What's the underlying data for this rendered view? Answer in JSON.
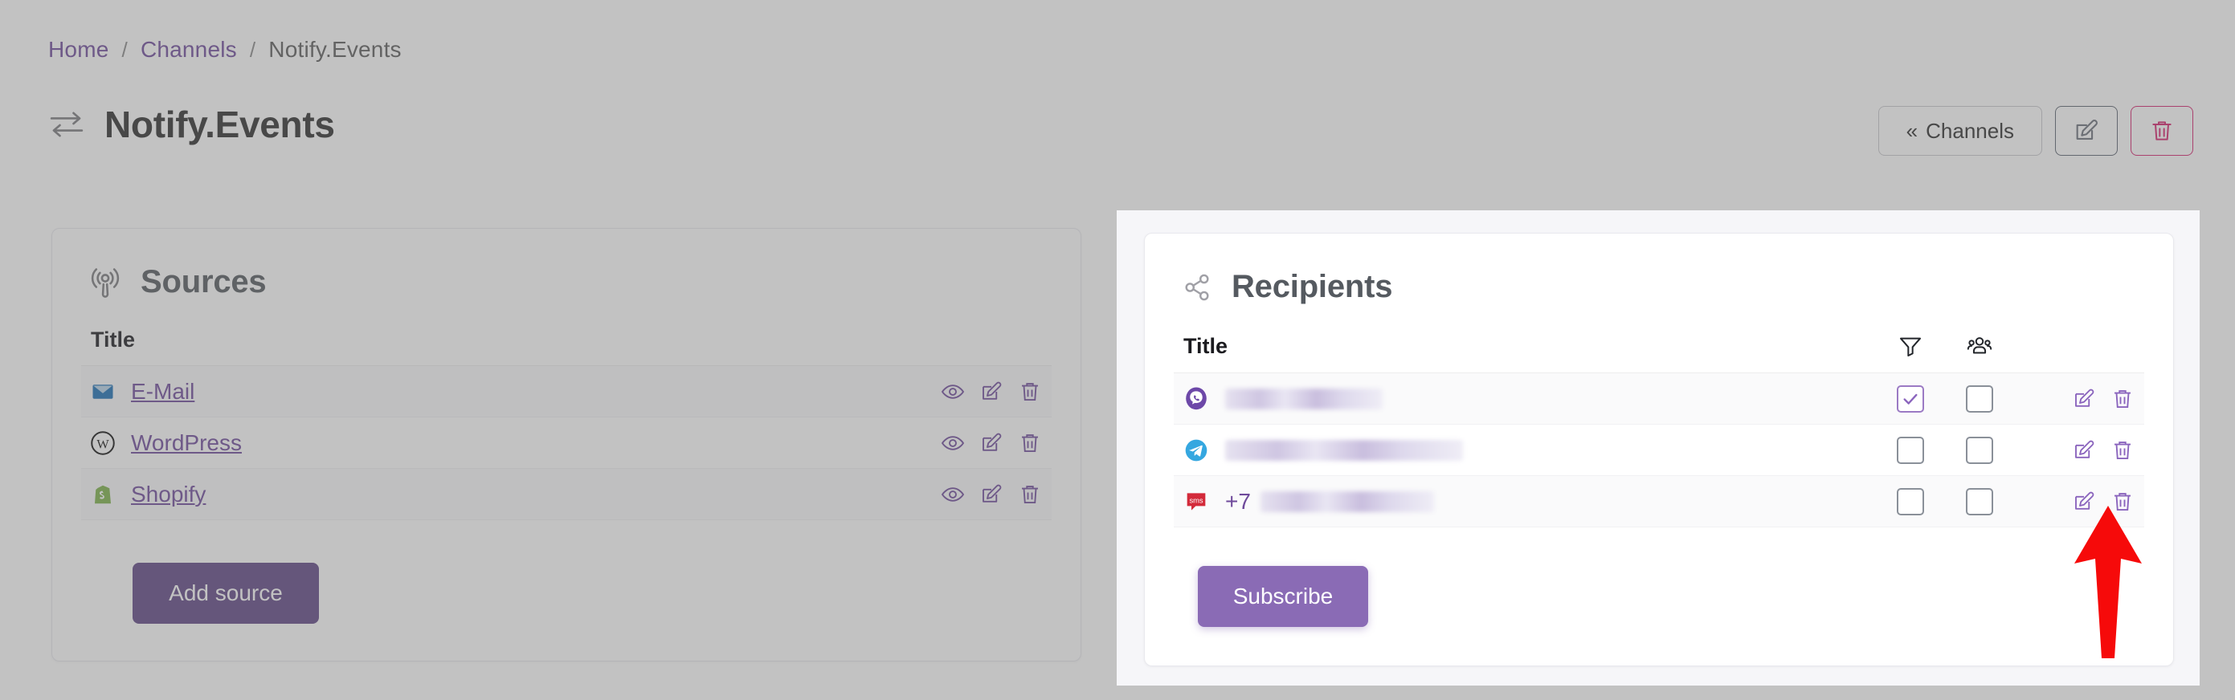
{
  "breadcrumb": {
    "items": [
      {
        "label": "Home",
        "type": "link"
      },
      {
        "label": "/",
        "type": "separator"
      },
      {
        "label": "Channels",
        "type": "link"
      },
      {
        "label": "/",
        "type": "separator"
      },
      {
        "label": "Notify.Events",
        "type": "current"
      }
    ]
  },
  "header": {
    "title": "Notify.Events",
    "title_icon": "exchange-arrows-icon",
    "back_button": {
      "label": "Channels",
      "chevron": "«"
    },
    "edit_button_icon": "edit-pencil-icon",
    "delete_button_icon": "trash-icon"
  },
  "sources": {
    "title": "Sources",
    "icon": "broadcast-icon",
    "columns": {
      "title": "Title"
    },
    "rows": [
      {
        "label": "E-Mail",
        "icon": "email-envelope-icon",
        "actions": [
          "eye-icon",
          "edit-pencil-icon",
          "trash-icon"
        ]
      },
      {
        "label": "WordPress",
        "icon": "wordpress-icon",
        "actions": [
          "eye-icon",
          "edit-pencil-icon",
          "trash-icon"
        ]
      },
      {
        "label": "Shopify",
        "icon": "shopify-icon",
        "actions": [
          "eye-icon",
          "edit-pencil-icon",
          "trash-icon"
        ]
      }
    ],
    "add_button_label": "Add source"
  },
  "recipients": {
    "title": "Recipients",
    "icon": "share-nodes-icon",
    "columns": {
      "title": "Title",
      "filter_icon": "filter-funnel-icon",
      "group_icon": "people-group-icon"
    },
    "rows": [
      {
        "label": "",
        "label_redacted": true,
        "redacted_width": 196,
        "prefix": "",
        "icon": "viber-icon",
        "filter_checked": true,
        "group_checked": false,
        "actions": [
          "edit-pencil-icon",
          "trash-icon"
        ]
      },
      {
        "label": "",
        "label_redacted": true,
        "redacted_width": 296,
        "prefix": "",
        "icon": "telegram-icon",
        "filter_checked": false,
        "group_checked": false,
        "actions": [
          "edit-pencil-icon",
          "trash-icon"
        ]
      },
      {
        "label": "",
        "label_redacted": true,
        "redacted_width": 216,
        "prefix": "+7",
        "icon": "sms-icon",
        "filter_checked": false,
        "group_checked": false,
        "actions": [
          "edit-pencil-icon",
          "trash-icon"
        ]
      }
    ],
    "subscribe_button_label": "Subscribe"
  },
  "annotation": {
    "arrow": "red-up-arrow",
    "color": "#f60a0a"
  },
  "colors": {
    "accent_purple": "#6f4a9b",
    "button_purple": "#8a6bb5",
    "button_purple_dim": "#5f4685",
    "delete_pink": "#d6246e",
    "annotation_red": "#f60a0a"
  }
}
